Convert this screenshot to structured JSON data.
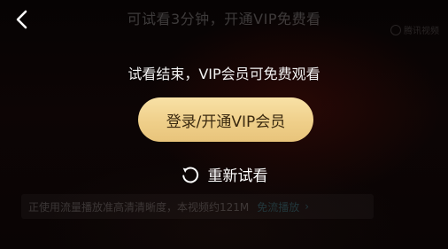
{
  "header": {
    "banner_text": "可试看3分钟，开通VIP免费看",
    "watermark_text": "腾讯视频"
  },
  "overlay": {
    "trial_ended_text": "试看结束，VIP会员可免费观看",
    "vip_button_label": "登录/开通VIP会员",
    "replay_label": "重新试看"
  },
  "notice": {
    "text": "正使用流量播放准高清清晰度，本视频约121M",
    "link_label": "免流播放",
    "chevron": "›"
  },
  "colors": {
    "vip_button_gold": "#efcf8a",
    "vip_button_text": "#3b2a10",
    "background": "#0a0404"
  },
  "icons": {
    "back": "chevron-left-icon",
    "replay": "replay-icon"
  }
}
